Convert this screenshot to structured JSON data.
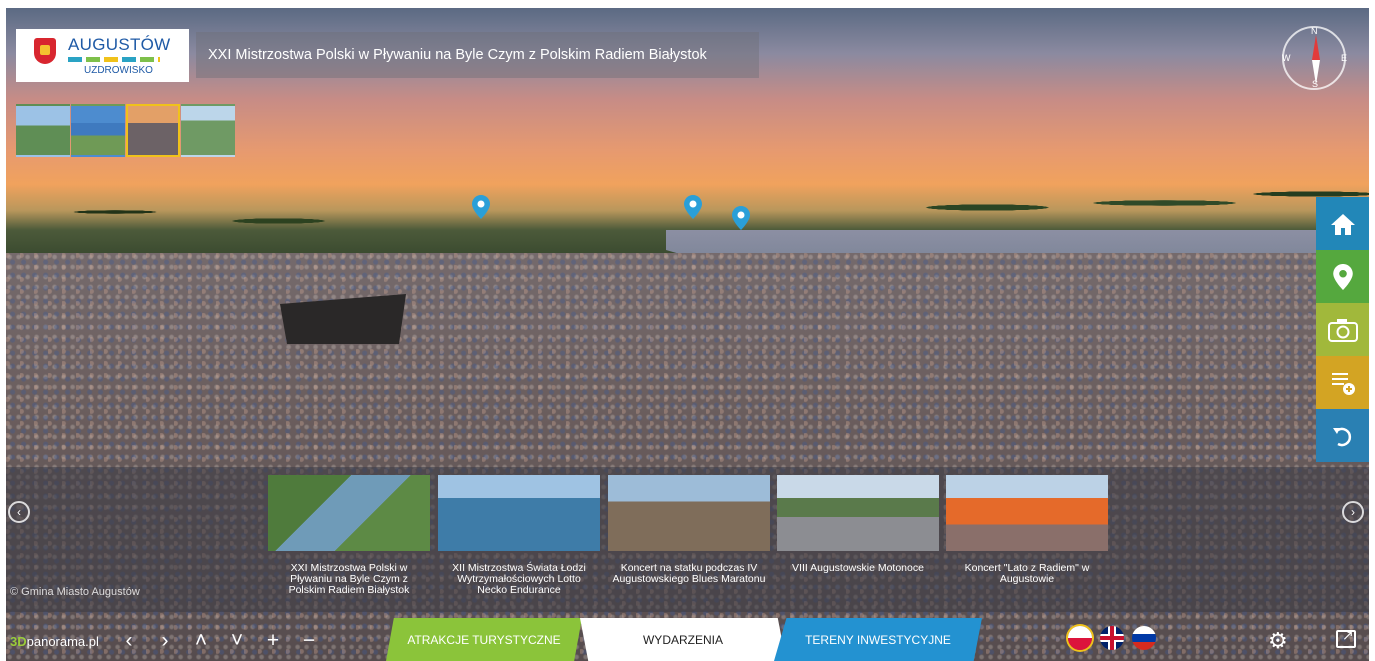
{
  "header": {
    "logo_name": "AUGUSTÓW",
    "logo_sub": "UZDROWISKO",
    "title": "XXI Mistrzostwa Polski w Pływaniu na Byle Czym z Polskim Radiem Białystok"
  },
  "compass": {
    "n": "N",
    "s": "S",
    "e": "E",
    "w": "W"
  },
  "thumbnails": [
    {
      "icon": "aerial-view",
      "active": false
    },
    {
      "icon": "lake-view",
      "active": false
    },
    {
      "icon": "concert-crowd",
      "active": true
    },
    {
      "icon": "town-view",
      "active": false
    }
  ],
  "side_menu": [
    "home-icon",
    "map-pin-icon",
    "camera-icon",
    "list-add-icon",
    "back-arrow-icon"
  ],
  "carousel": {
    "cards": [
      {
        "label": "XXI Mistrzostwa Polski w Pływaniu na Byle Czym z Polskim Radiem Białystok"
      },
      {
        "label": "XII Mistrzostwa Świata Łodzi Wytrzymałościowych Lotto Necko Endurance"
      },
      {
        "label": "Koncert na statku podczas IV Augustowskiego Blues Maratonu"
      },
      {
        "label": "VIII Augustowskie Motonoce"
      },
      {
        "label": "Koncert \"Lato z Radiem\" w Augustowie"
      }
    ],
    "copyright": "© Gmina Miasto Augustów"
  },
  "bottom": {
    "brand_3d": "3D",
    "brand_rest": "panorama.pl",
    "tabs": [
      "ATRAKCJE TURYSTYCZNE",
      "WYDARZENIA",
      "TERENY INWESTYCYJNE"
    ],
    "nav": [
      "‹",
      "›",
      "˄",
      "˅",
      "+",
      "−"
    ]
  },
  "colors": {
    "green": "#8bc43a",
    "blue": "#2392d1",
    "yellow": "#f0c21b"
  }
}
